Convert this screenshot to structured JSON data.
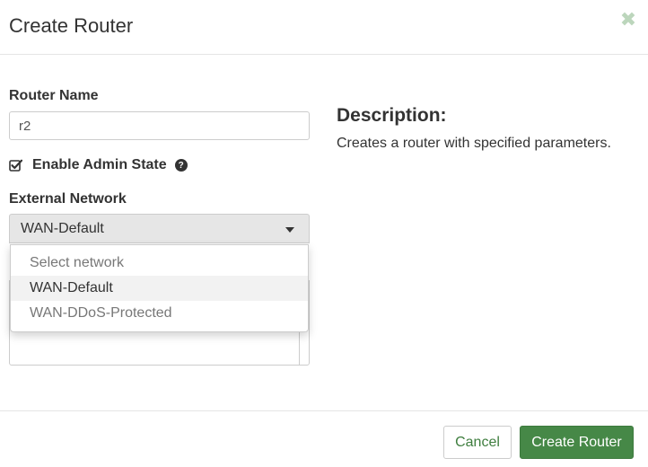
{
  "modal": {
    "title": "Create Router",
    "close_icon": "close-icon"
  },
  "form": {
    "router_name_label": "Router Name",
    "router_name_value": "r2",
    "admin_state_label": "Enable Admin State",
    "admin_state_checked": true,
    "help_icon_glyph": "?",
    "external_network_label": "External Network",
    "external_network_selected": "WAN-Default",
    "network_options": [
      "Select network",
      "WAN-Default",
      "WAN-DDoS-Protected"
    ]
  },
  "description": {
    "title": "Description:",
    "text": "Creates a router with specified parameters."
  },
  "footer": {
    "cancel_label": "Cancel",
    "submit_label": "Create Router"
  },
  "colors": {
    "primary": "#468847",
    "link": "#3f7e3f",
    "close": "#bcd6bc"
  }
}
